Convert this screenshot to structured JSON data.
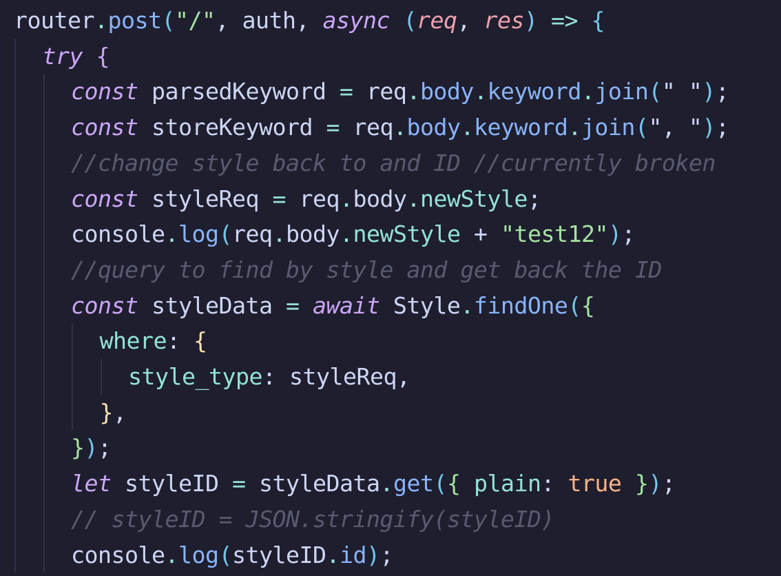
{
  "editor": {
    "theme": {
      "background": "#1e1e2e",
      "indent_guide": "#31324a"
    },
    "colors": {
      "plain": "#cdd6f4",
      "keyword": "#cba6f7",
      "function": "#89b4fa",
      "string": "#a6e3a1",
      "operator": "#94e2d5",
      "parameter": "#eba0ac",
      "comment": "#585b70",
      "boolean": "#fab387",
      "bracket_level_1": "#f9e2af",
      "bracket_level_2": "#cba6f7",
      "bracket_level_3": "#74c7ec",
      "bracket_level_4": "#a6e3a1"
    },
    "lines": [
      {
        "indent": 0,
        "tokens": [
          {
            "t": "router",
            "c": "plain"
          },
          {
            "t": ".",
            "c": "op"
          },
          {
            "t": "post",
            "c": "fn"
          },
          {
            "t": "(",
            "c": "b3"
          },
          {
            "t": "\"/\"",
            "c": "str"
          },
          {
            "t": ", ",
            "c": "plain"
          },
          {
            "t": "auth",
            "c": "plain"
          },
          {
            "t": ", ",
            "c": "plain"
          },
          {
            "t": "async",
            "c": "kw"
          },
          {
            "t": " ",
            "c": "plain"
          },
          {
            "t": "(",
            "c": "b3"
          },
          {
            "t": "req",
            "c": "param"
          },
          {
            "t": ", ",
            "c": "plain"
          },
          {
            "t": "res",
            "c": "param"
          },
          {
            "t": ")",
            "c": "b3"
          },
          {
            "t": " => ",
            "c": "op"
          },
          {
            "t": "{",
            "c": "b3"
          }
        ]
      },
      {
        "indent": 1,
        "tokens": [
          {
            "t": "try",
            "c": "kw"
          },
          {
            "t": " ",
            "c": "plain"
          },
          {
            "t": "{",
            "c": "b2"
          }
        ]
      },
      {
        "indent": 2,
        "tokens": [
          {
            "t": "const",
            "c": "kw"
          },
          {
            "t": " parsedKeyword",
            "c": "plain"
          },
          {
            "t": " = ",
            "c": "op"
          },
          {
            "t": "req",
            "c": "plain"
          },
          {
            "t": ".",
            "c": "op"
          },
          {
            "t": "body",
            "c": "fn"
          },
          {
            "t": ".",
            "c": "op"
          },
          {
            "t": "keyword",
            "c": "fn"
          },
          {
            "t": ".",
            "c": "op"
          },
          {
            "t": "join",
            "c": "fn"
          },
          {
            "t": "(",
            "c": "b3"
          },
          {
            "t": "\" \"",
            "c": "plain"
          },
          {
            "t": ")",
            "c": "b3"
          },
          {
            "t": ";",
            "c": "plain"
          }
        ]
      },
      {
        "indent": 2,
        "tokens": [
          {
            "t": "const",
            "c": "kw"
          },
          {
            "t": " storeKeyword",
            "c": "plain"
          },
          {
            "t": " = ",
            "c": "op"
          },
          {
            "t": "req",
            "c": "plain"
          },
          {
            "t": ".",
            "c": "op"
          },
          {
            "t": "body",
            "c": "fn"
          },
          {
            "t": ".",
            "c": "op"
          },
          {
            "t": "keyword",
            "c": "fn"
          },
          {
            "t": ".",
            "c": "op"
          },
          {
            "t": "join",
            "c": "fn"
          },
          {
            "t": "(",
            "c": "b3"
          },
          {
            "t": "\", \"",
            "c": "plain"
          },
          {
            "t": ")",
            "c": "b3"
          },
          {
            "t": ";",
            "c": "plain"
          }
        ]
      },
      {
        "indent": 2,
        "tokens": [
          {
            "t": "//change style back to and ID //currently broken",
            "c": "comment"
          }
        ]
      },
      {
        "indent": 2,
        "tokens": [
          {
            "t": "const",
            "c": "kw"
          },
          {
            "t": " styleReq",
            "c": "plain"
          },
          {
            "t": " = ",
            "c": "op"
          },
          {
            "t": "req",
            "c": "plain"
          },
          {
            "t": ".",
            "c": "op"
          },
          {
            "t": "body",
            "c": "plain"
          },
          {
            "t": ".",
            "c": "op"
          },
          {
            "t": "newStyle",
            "c": "op"
          },
          {
            "t": ";",
            "c": "plain"
          }
        ]
      },
      {
        "indent": 2,
        "tokens": [
          {
            "t": "console",
            "c": "plain"
          },
          {
            "t": ".",
            "c": "op"
          },
          {
            "t": "log",
            "c": "fn"
          },
          {
            "t": "(",
            "c": "b3"
          },
          {
            "t": "req",
            "c": "plain"
          },
          {
            "t": ".",
            "c": "op"
          },
          {
            "t": "body",
            "c": "plain"
          },
          {
            "t": ".",
            "c": "op"
          },
          {
            "t": "newStyle",
            "c": "op"
          },
          {
            "t": " + ",
            "c": "plain"
          },
          {
            "t": "\"test12\"",
            "c": "str"
          },
          {
            "t": ")",
            "c": "b3"
          },
          {
            "t": ";",
            "c": "plain"
          }
        ]
      },
      {
        "indent": 2,
        "tokens": [
          {
            "t": "//query to find by style and get back the ID",
            "c": "comment"
          }
        ]
      },
      {
        "indent": 2,
        "tokens": [
          {
            "t": "const",
            "c": "kw"
          },
          {
            "t": " styleData",
            "c": "plain"
          },
          {
            "t": " = ",
            "c": "op"
          },
          {
            "t": "await",
            "c": "kw"
          },
          {
            "t": " Style",
            "c": "plain"
          },
          {
            "t": ".",
            "c": "op"
          },
          {
            "t": "findOne",
            "c": "fn"
          },
          {
            "t": "(",
            "c": "b3"
          },
          {
            "t": "{",
            "c": "b4"
          }
        ]
      },
      {
        "indent": 3,
        "tokens": [
          {
            "t": "where",
            "c": "prop"
          },
          {
            "t": ": ",
            "c": "plain"
          },
          {
            "t": "{",
            "c": "b1"
          }
        ]
      },
      {
        "indent": 4,
        "tokens": [
          {
            "t": "style_type",
            "c": "prop"
          },
          {
            "t": ": ",
            "c": "plain"
          },
          {
            "t": "styleReq",
            "c": "plain"
          },
          {
            "t": ",",
            "c": "plain"
          }
        ]
      },
      {
        "indent": 3,
        "tokens": [
          {
            "t": "}",
            "c": "b1"
          },
          {
            "t": ",",
            "c": "plain"
          }
        ]
      },
      {
        "indent": 2,
        "tokens": [
          {
            "t": "}",
            "c": "b4"
          },
          {
            "t": ")",
            "c": "b3"
          },
          {
            "t": ";",
            "c": "plain"
          }
        ]
      },
      {
        "indent": 2,
        "tokens": [
          {
            "t": "let",
            "c": "kw"
          },
          {
            "t": " styleID",
            "c": "plain"
          },
          {
            "t": " = ",
            "c": "op"
          },
          {
            "t": "styleData",
            "c": "plain"
          },
          {
            "t": ".",
            "c": "op"
          },
          {
            "t": "get",
            "c": "fn"
          },
          {
            "t": "(",
            "c": "b3"
          },
          {
            "t": "{ ",
            "c": "b4"
          },
          {
            "t": "plain",
            "c": "prop"
          },
          {
            "t": ": ",
            "c": "plain"
          },
          {
            "t": "true",
            "c": "bool"
          },
          {
            "t": " }",
            "c": "b4"
          },
          {
            "t": ")",
            "c": "b3"
          },
          {
            "t": ";",
            "c": "plain"
          }
        ]
      },
      {
        "indent": 2,
        "tokens": [
          {
            "t": "// styleID = JSON.stringify(styleID)",
            "c": "comment"
          }
        ]
      },
      {
        "indent": 2,
        "tokens": [
          {
            "t": "console",
            "c": "plain"
          },
          {
            "t": ".",
            "c": "op"
          },
          {
            "t": "log",
            "c": "fn"
          },
          {
            "t": "(",
            "c": "b3"
          },
          {
            "t": "styleID",
            "c": "plain"
          },
          {
            "t": ".",
            "c": "op"
          },
          {
            "t": "id",
            "c": "fn"
          },
          {
            "t": ")",
            "c": "b3"
          },
          {
            "t": ";",
            "c": "plain"
          }
        ]
      }
    ]
  }
}
